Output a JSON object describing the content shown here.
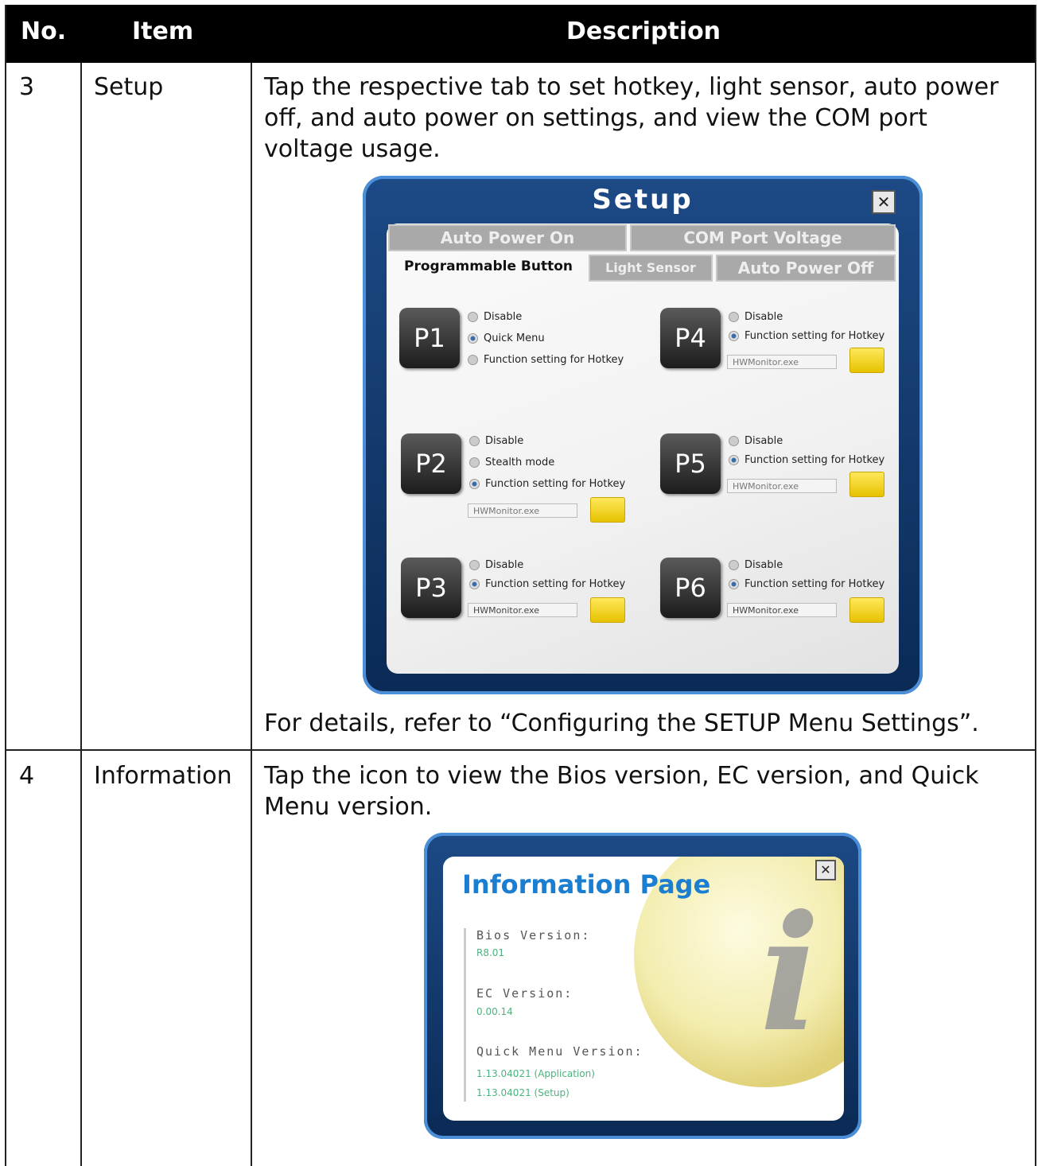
{
  "table": {
    "headers": {
      "no": "No.",
      "item": "Item",
      "description": "Description"
    },
    "rows": [
      {
        "no": "3",
        "item": "Setup",
        "description": "Tap the respective tab to set hotkey, light sensor, auto power off, and auto power on settings, and view the COM port voltage usage.",
        "footer": "For details, refer to “Configuring the SETUP Menu Settings”."
      },
      {
        "no": "4",
        "item": "Information",
        "description": "Tap the icon to view the Bios version, EC version, and Quick Menu version."
      }
    ]
  },
  "setup_dialog": {
    "title": "Setup",
    "close": "✕",
    "tabs": {
      "auto_power_on": "Auto Power On",
      "com_port_voltage": "COM Port Voltage",
      "programmable_button": "Programmable Button",
      "light_sensor": "Light Sensor",
      "auto_power_off": "Auto Power Off"
    },
    "buttons": {
      "p1": {
        "label": "P1",
        "opt1": "Disable",
        "opt2": "Quick Menu",
        "opt3": "Function setting for Hotkey"
      },
      "p2": {
        "label": "P2",
        "opt1": "Disable",
        "opt2": "Stealth mode",
        "opt3": "Function setting for Hotkey",
        "file": "HWMonitor.exe"
      },
      "p3": {
        "label": "P3",
        "opt1": "Disable",
        "opt2": "Function setting for Hotkey",
        "file": "HWMonitor.exe"
      },
      "p4": {
        "label": "P4",
        "opt1": "Disable",
        "opt2": "Function setting for Hotkey",
        "file": "HWMonitor.exe"
      },
      "p5": {
        "label": "P5",
        "opt1": "Disable",
        "opt2": "Function setting for Hotkey",
        "file": "HWMonitor.exe"
      },
      "p6": {
        "label": "P6",
        "opt1": "Disable",
        "opt2": "Function setting for Hotkey",
        "file": "HWMonitor.exe"
      }
    }
  },
  "info_dialog": {
    "title": "Information Page",
    "close": "✕",
    "bios_label": "Bios Version:",
    "bios_value": "R8.01",
    "ec_label": "EC Version:",
    "ec_value": "0.00.14",
    "qm_label": "Quick Menu Version:",
    "qm_value1": "1.13.04021 (Application)",
    "qm_value2": "1.13.04021 (Setup)",
    "icon": "i"
  }
}
